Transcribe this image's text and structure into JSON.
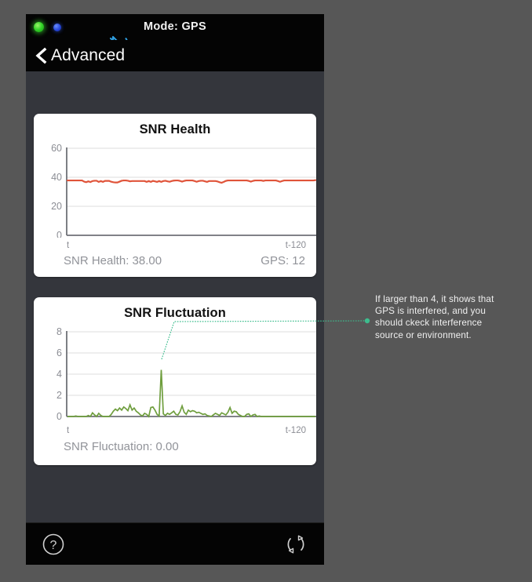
{
  "status_bar": {
    "mode_label": "Mode: GPS",
    "indicators": [
      {
        "name": "gps-fix-led",
        "state": "green"
      },
      {
        "name": "secondary-led",
        "state": "blue"
      },
      {
        "name": "bluetooth-icon",
        "state": "connected"
      }
    ]
  },
  "nav": {
    "back_label": "Advanced",
    "back_icon": "chevron-left-icon"
  },
  "toolbar": {
    "help_icon": "question-circle-icon",
    "refresh_icon": "refresh-cycle-icon"
  },
  "annotation": {
    "lines": [
      "If larger than 4, it shows that",
      "GPS is interfered, and you",
      "should ckeck interference",
      "source or environment."
    ],
    "color": "#3dbd8e"
  },
  "colors": {
    "background": "#575757",
    "device_body": "#34363c",
    "bar_black": "#040404",
    "card": "#ffffff",
    "snr_health_line": "#e0543a",
    "snr_fluctuation_line": "#6f9e3e",
    "annotation_leader": "#3dbd8e",
    "axis": "#6f7177",
    "grid": "#e9e9e9",
    "muted_text": "#919399"
  },
  "cards": [
    {
      "id": "snr-health",
      "title": "SNR Health",
      "axis_left": "t",
      "axis_right": "t-120",
      "footer_left": "SNR Health: 38.00",
      "footer_right": "GPS: 12"
    },
    {
      "id": "snr-fluctuation",
      "title": "SNR Fluctuation",
      "axis_left": "t",
      "axis_right": "t-120",
      "footer_left": "SNR Fluctuation: 0.00",
      "footer_right": ""
    }
  ],
  "chart_data": [
    {
      "type": "line",
      "id": "snr-health",
      "title": "SNR Health",
      "xlabel": "",
      "ylabel": "",
      "ylim": [
        0,
        60
      ],
      "yticks": [
        0,
        20,
        40,
        60
      ],
      "xtick_labels": [
        "t",
        "t-120"
      ],
      "grid": true,
      "legend": "none",
      "current_value": 38.0,
      "satellites_label": "GPS: 12",
      "satellites": 12,
      "series": [
        {
          "name": "SNR Health",
          "color": "#e0543a",
          "values": [
            37.8,
            37.8,
            37.8,
            37.8,
            37.8,
            37.8,
            37.8,
            37.8,
            37.0,
            36.6,
            37.2,
            36.7,
            37.4,
            37.6,
            37.6,
            36.8,
            37.4,
            36.8,
            37.5,
            37.5,
            37.5,
            36.9,
            36.6,
            36.4,
            36.4,
            37.0,
            37.6,
            37.8,
            37.8,
            37.6,
            37.2,
            37.4,
            37.4,
            37.4,
            37.4,
            37.4,
            37.4,
            37.4,
            36.8,
            37.4,
            36.8,
            37.5,
            37.2,
            36.8,
            37.4,
            36.8,
            37.4,
            37.6,
            37.2,
            36.9,
            37.4,
            37.7,
            37.8,
            37.8,
            37.5,
            37.0,
            37.5,
            37.8,
            37.8,
            37.8,
            37.8,
            37.4,
            36.9,
            37.4,
            37.6,
            37.6,
            37.2,
            36.8,
            37.4,
            37.4,
            37.4,
            37.4,
            37.1,
            36.6,
            36.2,
            36.8,
            37.5,
            37.8,
            37.8,
            37.8,
            37.8,
            37.8,
            37.8,
            37.8,
            37.8,
            37.8,
            37.8,
            37.5,
            37.0,
            37.5,
            37.8,
            37.8,
            37.8,
            37.8,
            37.5,
            37.8,
            37.8,
            37.8,
            37.8,
            37.8,
            37.8,
            37.4,
            36.9,
            37.4,
            37.8,
            37.8,
            37.8,
            37.8,
            37.8,
            37.8,
            37.8,
            37.8,
            37.8,
            37.8,
            37.8,
            37.8,
            37.8,
            37.8,
            37.8,
            38.0
          ]
        }
      ]
    },
    {
      "type": "area",
      "id": "snr-fluctuation",
      "title": "SNR Fluctuation",
      "xlabel": "",
      "ylabel": "",
      "ylim": [
        0,
        8
      ],
      "yticks": [
        0,
        2,
        4,
        6,
        8
      ],
      "xtick_labels": [
        "t",
        "t-120"
      ],
      "grid": true,
      "legend": "none",
      "current_value": 0.0,
      "threshold": 4,
      "peak_value": 4.4,
      "peak_index": 45,
      "series": [
        {
          "name": "SNR Fluctuation",
          "color": "#6f9e3e",
          "values": [
            0.0,
            0.0,
            0.0,
            0.0,
            0.05,
            0.0,
            0.0,
            0.0,
            0.0,
            0.0,
            0.1,
            0.0,
            0.35,
            0.15,
            0.0,
            0.3,
            0.1,
            0.0,
            0.0,
            0.0,
            0.0,
            0.2,
            0.5,
            0.7,
            0.55,
            0.8,
            0.6,
            0.9,
            0.75,
            0.55,
            1.1,
            0.6,
            0.8,
            0.5,
            0.35,
            0.15,
            0.05,
            0.3,
            0.2,
            0.0,
            0.85,
            0.9,
            0.6,
            0.2,
            0.05,
            4.4,
            0.25,
            0.1,
            0.3,
            0.2,
            0.35,
            0.5,
            0.2,
            0.15,
            0.45,
            1.0,
            0.4,
            0.2,
            0.6,
            0.45,
            0.55,
            0.5,
            0.35,
            0.4,
            0.3,
            0.2,
            0.25,
            0.1,
            0.05,
            0.0,
            0.15,
            0.3,
            0.2,
            0.1,
            0.35,
            0.25,
            0.15,
            0.4,
            0.85,
            0.3,
            0.5,
            0.45,
            0.2,
            0.1,
            0.0,
            0.0,
            0.2,
            0.25,
            0.0,
            0.15,
            0.2,
            0.0,
            0.05,
            0.0,
            0.0,
            0.0,
            0.0,
            0.0,
            0.0,
            0.0,
            0.0,
            0.0,
            0.0,
            0.0,
            0.0,
            0.0,
            0.0,
            0.0,
            0.0,
            0.0,
            0.0,
            0.0,
            0.0,
            0.0,
            0.0,
            0.0,
            0.0,
            0.0,
            0.0,
            0.0
          ]
        }
      ]
    }
  ]
}
